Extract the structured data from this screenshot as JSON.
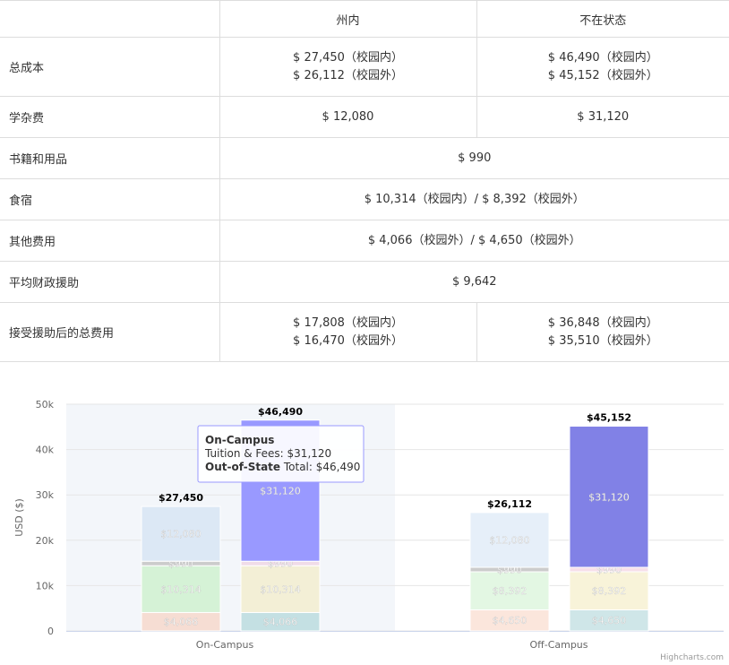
{
  "table": {
    "headers": [
      "",
      "州内",
      "不在状态"
    ],
    "rows": [
      {
        "label": "总成本",
        "cells": [
          [
            "$ 27,450（校园内）",
            "$ 26,112（校园外）"
          ],
          [
            "$ 46,490（校园内）",
            "$ 45,152（校园外）"
          ]
        ]
      },
      {
        "label": "学杂费",
        "cells": [
          [
            "$ 12,080"
          ],
          [
            "$ 31,120"
          ]
        ]
      },
      {
        "label": "书籍和用品",
        "span": [
          "$ 990"
        ]
      },
      {
        "label": "食宿",
        "span": [
          "$ 10,314（校园内）/ $ 8,392（校园外）"
        ]
      },
      {
        "label": "其他费用",
        "span": [
          "$ 4,066（校园外）/ $ 4,650（校园外）"
        ]
      },
      {
        "label": "平均财政援助",
        "span": [
          "$ 9,642"
        ]
      },
      {
        "label": "接受援助后的总费用",
        "cells": [
          [
            "$ 17,808（校园内）",
            "$ 16,470（校园外）"
          ],
          [
            "$ 36,848（校园内）",
            "$ 35,510（校园外）"
          ]
        ]
      }
    ]
  },
  "chart_data": {
    "type": "bar",
    "stacked": true,
    "categories": [
      "On-Campus",
      "Off-Campus"
    ],
    "ylabel": "USD ($)",
    "ylim": [
      0,
      50000
    ],
    "yticks": [
      "0",
      "10k",
      "20k",
      "30k",
      "40k",
      "50k"
    ],
    "grid": true,
    "stacks": [
      {
        "category": "On-Campus",
        "group": "In-State",
        "total_label": "$27,450",
        "segments": [
          {
            "value": 4066,
            "label": "$4,066",
            "color": "#f6ddd3"
          },
          {
            "value": 10314,
            "label": "$10,314",
            "color": "#d5f2d6"
          },
          {
            "value": 990,
            "label": "$990",
            "color": "#cccccc"
          },
          {
            "value": 12080,
            "label": "$12,080",
            "color": "#dce8f5"
          }
        ]
      },
      {
        "category": "On-Campus",
        "group": "Out-of-State",
        "total_label": "$46,490",
        "segments": [
          {
            "value": 4066,
            "label": "$4,066",
            "color": "#c4e0e3"
          },
          {
            "value": 10314,
            "label": "$10,314",
            "color": "#f3efd6"
          },
          {
            "value": 990,
            "label": "$990",
            "color": "#f0dce8"
          },
          {
            "value": 31120,
            "label": "$31,120",
            "color": "#9999ff"
          }
        ]
      },
      {
        "category": "Off-Campus",
        "group": "In-State",
        "total_label": "$26,112",
        "segments": [
          {
            "value": 4650,
            "label": "$4,650",
            "color": "#fbe6dc"
          },
          {
            "value": 8392,
            "label": "$8,392",
            "color": "#e3f7e3"
          },
          {
            "value": 990,
            "label": "$990",
            "color": "#cccccc"
          },
          {
            "value": 12080,
            "label": "$12,080",
            "color": "#e6eff9"
          }
        ]
      },
      {
        "category": "Off-Campus",
        "group": "Out-of-State",
        "total_label": "$45,152",
        "segments": [
          {
            "value": 4650,
            "label": "$4,650",
            "color": "#cfe6e8"
          },
          {
            "value": 8392,
            "label": "$8,392",
            "color": "#f8f3d9"
          },
          {
            "value": 990,
            "label": "$990",
            "color": "#f7e0ea"
          },
          {
            "value": 31120,
            "label": "$31,120",
            "color": "#8181e6"
          }
        ]
      }
    ],
    "tooltip": {
      "title": "On-Campus",
      "line1": "Tuition & Fees: $31,120",
      "line2_bold": "Out-of-State",
      "line2_rest": " Total: $46,490"
    },
    "credits": "Highcharts.com",
    "hover_color": "#f3f6fa"
  }
}
